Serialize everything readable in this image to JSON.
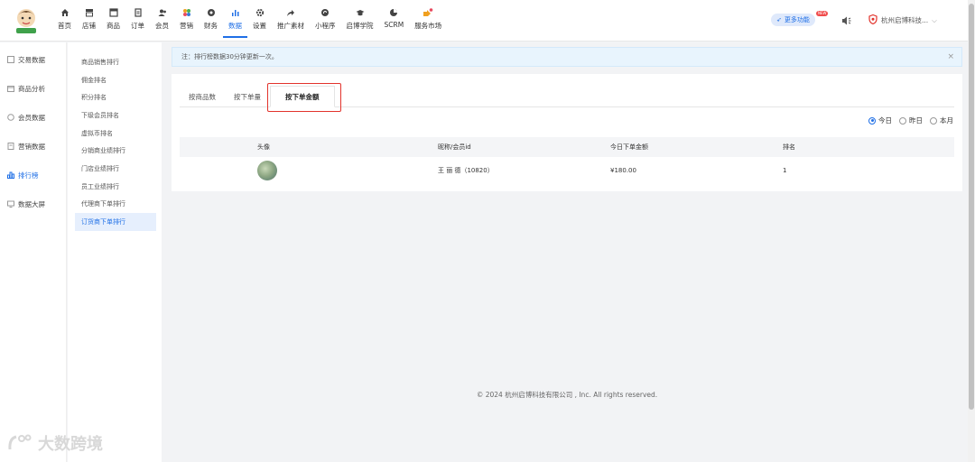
{
  "nav": {
    "items": [
      {
        "label": "首页",
        "icon": "home-icon"
      },
      {
        "label": "店铺",
        "icon": "store-icon"
      },
      {
        "label": "商品",
        "icon": "goods-icon"
      },
      {
        "label": "订单",
        "icon": "order-icon"
      },
      {
        "label": "会员",
        "icon": "member-icon"
      },
      {
        "label": "营销",
        "icon": "marketing-icon"
      },
      {
        "label": "财务",
        "icon": "finance-icon"
      },
      {
        "label": "数据",
        "icon": "data-chart-icon",
        "active": true
      },
      {
        "label": "设置",
        "icon": "gear-icon"
      },
      {
        "label": "推广素材",
        "icon": "share-icon"
      },
      {
        "label": "小程序",
        "icon": "miniprogram-icon"
      },
      {
        "label": "启博学院",
        "icon": "graduation-cap-icon"
      },
      {
        "label": "SCRM",
        "icon": "scrm-icon"
      },
      {
        "label": "服务市场",
        "icon": "service-market-icon"
      }
    ],
    "accent": "#1f6fe6"
  },
  "header_right": {
    "more_functions": "更多功能",
    "hot_badge": "NEW",
    "company": "杭州启博科技..."
  },
  "sidebar": {
    "items": [
      {
        "label": "交易数据",
        "icon": "trade-icon"
      },
      {
        "label": "商品分析",
        "icon": "goods-analysis-icon"
      },
      {
        "label": "会员数据",
        "icon": "member-data-icon"
      },
      {
        "label": "营销数据",
        "icon": "marketing-data-icon"
      },
      {
        "label": "排行榜",
        "icon": "ranking-icon",
        "active": true
      },
      {
        "label": "数据大屏",
        "icon": "screen-icon"
      }
    ]
  },
  "subsidebar": {
    "items": [
      {
        "label": "商品销售排行"
      },
      {
        "label": "佣金排名"
      },
      {
        "label": "积分排名"
      },
      {
        "label": "下级会员排名"
      },
      {
        "label": "虚拟币排名"
      },
      {
        "label": "分销商业绩排行"
      },
      {
        "label": "门店业绩排行"
      },
      {
        "label": "员工业绩排行"
      },
      {
        "label": "代理商下单排行"
      },
      {
        "label": "订货商下单排行",
        "active": true
      }
    ]
  },
  "notice": {
    "text": "注：排行榜数据30分钟更新一次。",
    "close": "×"
  },
  "tabs": [
    {
      "label": "按商品数"
    },
    {
      "label": "按下单量"
    },
    {
      "label": "按下单金额",
      "active": true
    }
  ],
  "radios": [
    {
      "label": "今日",
      "checked": true
    },
    {
      "label": "昨日",
      "checked": false
    },
    {
      "label": "本月",
      "checked": false
    }
  ],
  "table": {
    "columns": [
      "头像",
      "昵称/会员id",
      "今日下单金额",
      "排名"
    ],
    "rows": [
      {
        "nickname": "王 丽 德（10820）",
        "amount": "¥180.00",
        "rank": "1"
      }
    ]
  },
  "footer": "© 2024 杭州启博科技有限公司 , Inc. All rights reserved.",
  "watermark": "大数跨境"
}
